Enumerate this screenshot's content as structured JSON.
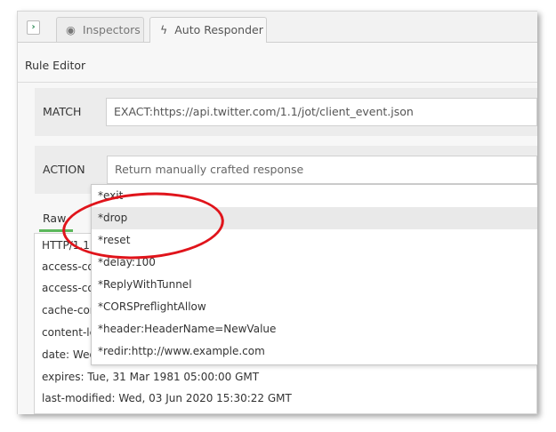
{
  "tabs": [
    {
      "label": "Inspectors",
      "icon": "eye-icon"
    },
    {
      "label": "Auto Responder",
      "icon": "lightning-icon"
    }
  ],
  "section_title": "Rule Editor",
  "match": {
    "label": "MATCH",
    "value": "EXACT:https://api.twitter.com/1.1/jot/client_event.json"
  },
  "action": {
    "label": "ACTION",
    "placeholder": "Return manually crafted response"
  },
  "raw_tab": "Raw",
  "headers": [
    "HTTP/1.1",
    "access-co",
    "access-co",
    "cache-con",
    "content-le",
    "date: Wed",
    "expires: Tue, 31 Mar 1981 05:00:00 GMT",
    "last-modified: Wed, 03 Jun 2020 15:30:22 GMT"
  ],
  "dropdown_options": [
    "*exit",
    "*drop",
    "*reset",
    "*delay:100",
    "*ReplyWithTunnel",
    "*CORSPreflightAllow",
    "*header:HeaderName=NewValue",
    "*redir:http://www.example.com"
  ],
  "selected_option": "*drop",
  "colors": {
    "accent_green": "#5cb85c",
    "annotation_red": "#e0141b"
  }
}
